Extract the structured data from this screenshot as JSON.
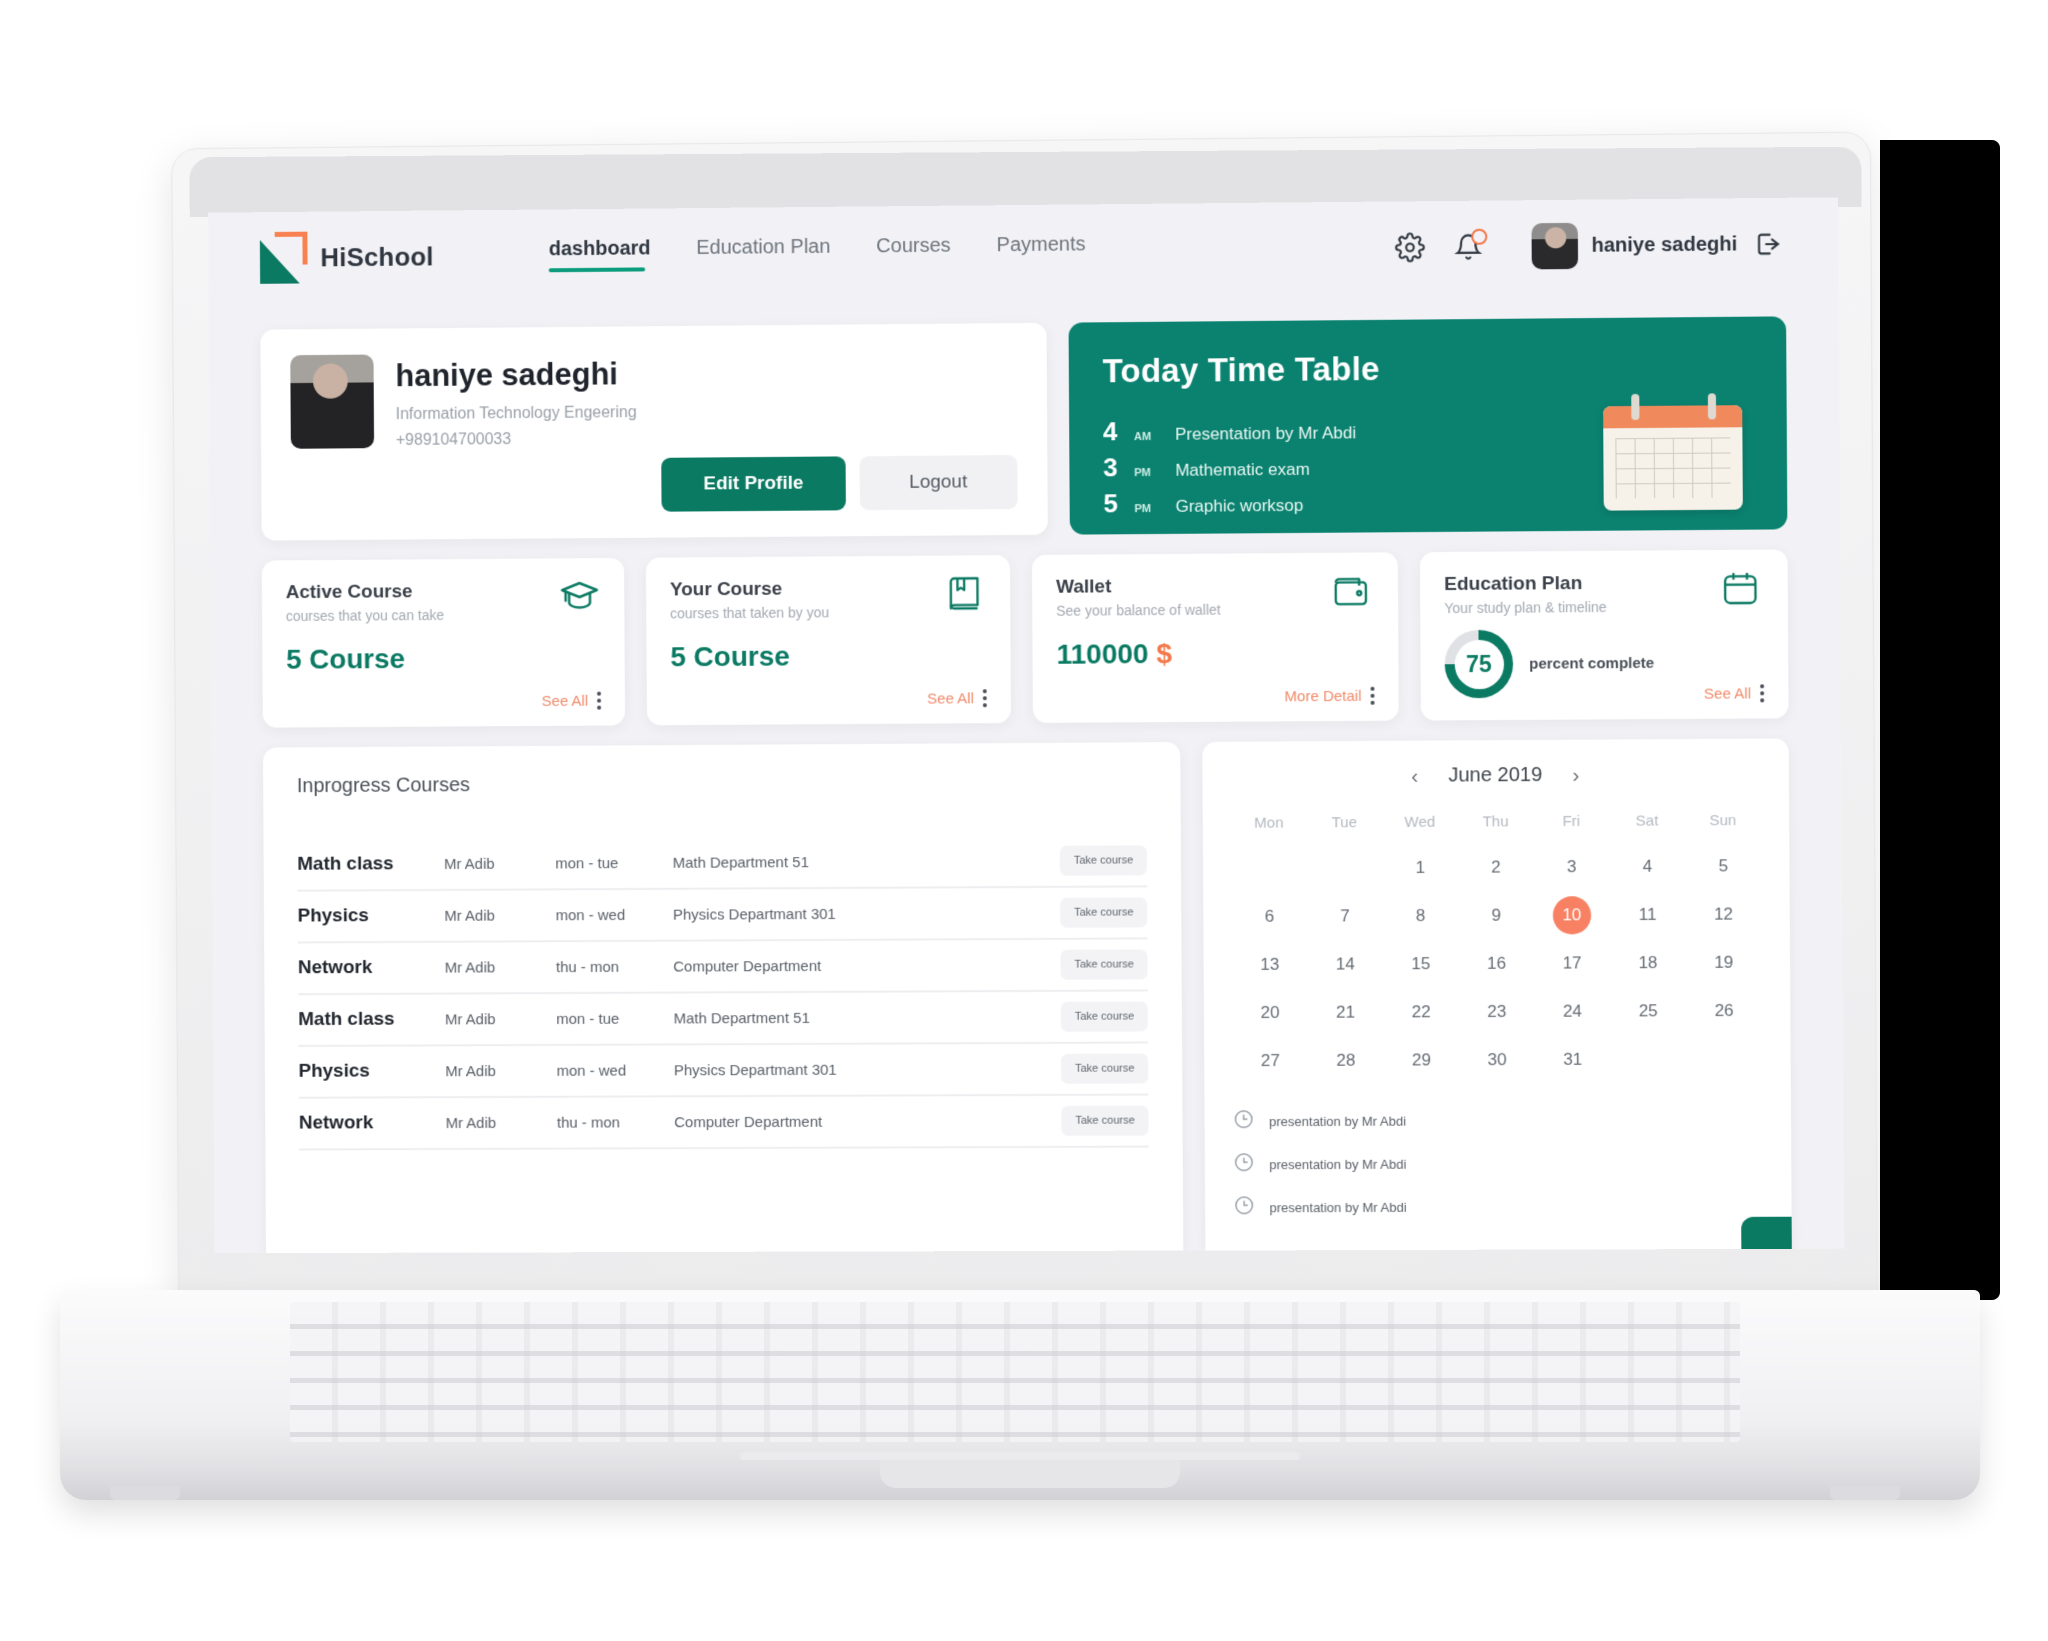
{
  "brand": {
    "name": "HiSchool",
    "logo_icon": "hischool-logo-icon"
  },
  "nav": {
    "items": [
      {
        "label": "dashboard",
        "active": true
      },
      {
        "label": "Education Plan",
        "active": false
      },
      {
        "label": "Courses",
        "active": false
      },
      {
        "label": "Payments",
        "active": false
      }
    ]
  },
  "topright": {
    "settings_icon": "gear-icon",
    "notifications_icon": "bell-icon",
    "user_name": "haniye sadeghi",
    "logout_icon": "logout-arrow-icon"
  },
  "profile": {
    "name": "haniye sadeghi",
    "field": "Information Technology Engeering",
    "phone": "+989104700033",
    "edit_label": "Edit Profile",
    "logout_label": "Logout"
  },
  "timetable": {
    "title": "Today Time Table",
    "entries": [
      {
        "hour": "4",
        "ampm": "AM",
        "label": "Presentation by Mr Abdi"
      },
      {
        "hour": "3",
        "ampm": "PM",
        "label": "Mathematic exam"
      },
      {
        "hour": "5",
        "ampm": "PM",
        "label": "Graphic worksop"
      }
    ]
  },
  "stats": [
    {
      "title": "Active Course",
      "subtitle": "courses that you can take",
      "value": "5 Course",
      "link": "See All",
      "icon": "graduation-cap-icon"
    },
    {
      "title": "Your Course",
      "subtitle": "courses that taken by you",
      "value": "5 Course",
      "link": "See All",
      "icon": "book-icon"
    },
    {
      "title": "Wallet",
      "subtitle": "See your balance of wallet",
      "value": "110000",
      "currency": "$",
      "link": "More Detail",
      "icon": "wallet-icon"
    },
    {
      "title": "Education Plan",
      "subtitle": "Your study plan & timeline",
      "percent": "75",
      "percent_label": "percent complete",
      "link": "See All",
      "icon": "calendar-icon"
    }
  ],
  "courses": {
    "title": "Inprogress Courses",
    "action_label": "Take course",
    "rows": [
      {
        "name": "Math class",
        "teacher": "Mr Adib",
        "days": "mon - tue",
        "dept": "Math Department 51"
      },
      {
        "name": "Physics",
        "teacher": "Mr Adib",
        "days": "mon - wed",
        "dept": "Physics Departmant 301"
      },
      {
        "name": "Network",
        "teacher": "Mr Adib",
        "days": "thu - mon",
        "dept": "Computer Department"
      },
      {
        "name": "Math class",
        "teacher": "Mr Adib",
        "days": "mon - tue",
        "dept": "Math Department 51"
      },
      {
        "name": "Physics",
        "teacher": "Mr Adib",
        "days": "mon - wed",
        "dept": "Physics Departmant 301"
      },
      {
        "name": "Network",
        "teacher": "Mr Adib",
        "days": "thu - mon",
        "dept": "Computer Department"
      }
    ]
  },
  "calendar": {
    "month": "June 2019",
    "prev_icon": "chevron-left-icon",
    "next_icon": "chevron-right-icon",
    "dows": [
      "Mon",
      "Tue",
      "Wed",
      "Thu",
      "Fri",
      "Sat",
      "Sun"
    ],
    "leading_blanks": 2,
    "days": [
      1,
      2,
      3,
      4,
      5,
      6,
      7,
      8,
      9,
      10,
      11,
      12,
      13,
      14,
      15,
      16,
      17,
      18,
      19,
      20,
      21,
      22,
      23,
      24,
      25,
      26,
      27,
      28,
      29,
      30,
      31
    ],
    "today": 10,
    "events": [
      {
        "icon": "clock-icon",
        "text": "presentation by Mr Abdi"
      },
      {
        "icon": "clock-icon",
        "text": "presentation by Mr Abdi"
      },
      {
        "icon": "clock-icon",
        "text": "presentation by Mr Abdi"
      }
    ]
  },
  "colors": {
    "green": "#0b7a63",
    "teal": "#0b8270",
    "orange": "#f4774a",
    "coral": "#f98163",
    "bg": "#f2f2f6"
  }
}
